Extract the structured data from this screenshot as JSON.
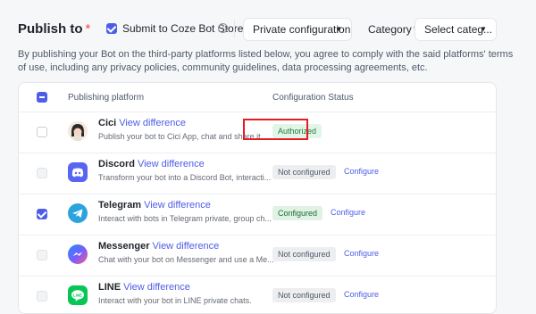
{
  "header": {
    "title": "Publish to",
    "required_mark": "*",
    "submit_label": "Submit to Coze Bot Store",
    "submit_checked": true,
    "info_glyph": "i",
    "private_config": {
      "label": "Private configuration",
      "caret": "▼"
    },
    "category": {
      "label": "Category",
      "required_mark": "*",
      "placeholder": "Select categ...",
      "caret": "▼"
    }
  },
  "description": "By publishing your Bot on the third-party platforms listed below, you agree to comply with the said platforms' terms of use, including any privacy policies, community guidelines, data processing agreements, etc.",
  "table": {
    "columns": {
      "platform": "Publishing platform",
      "status": "Configuration Status"
    },
    "rows": [
      {
        "name": "Cici",
        "view_diff": "View difference",
        "desc": "Publish your bot to Cici App, chat and share it ...",
        "status": "Authorized",
        "status_kind": "authorized",
        "configure": "",
        "checkbox": "unchecked",
        "icon": "cici-avatar-icon",
        "icon_color": "#f3e9df"
      },
      {
        "name": "Discord",
        "view_diff": "View difference",
        "desc": "Transform your bot into a Discord Bot, interacti...",
        "status": "Not configured",
        "status_kind": "not-configured",
        "configure": "Configure",
        "checkbox": "disabled",
        "icon": "discord-icon",
        "icon_color": "#5865f2"
      },
      {
        "name": "Telegram",
        "view_diff": "View difference",
        "desc": "Interact with bots in Telegram private, group ch...",
        "status": "Configured",
        "status_kind": "configured",
        "configure": "Configure",
        "checkbox": "checked",
        "icon": "telegram-icon",
        "icon_color": "#2aa3df"
      },
      {
        "name": "Messenger",
        "view_diff": "View difference",
        "desc": "Chat with your bot on Messenger and use a Me...",
        "status": "Not configured",
        "status_kind": "not-configured",
        "configure": "Configure",
        "checkbox": "disabled",
        "icon": "messenger-icon",
        "icon_color": "#7b5cfa"
      },
      {
        "name": "LINE",
        "view_diff": "View difference",
        "desc": "Interact with your bot in LINE private chats.",
        "status": "Not configured",
        "status_kind": "not-configured",
        "configure": "Configure",
        "checkbox": "disabled",
        "icon": "line-icon",
        "icon_color": "#06c755"
      }
    ]
  },
  "colors": {
    "accent": "#4e5de6",
    "highlight": "#e51c23",
    "required": "#f54a45"
  }
}
